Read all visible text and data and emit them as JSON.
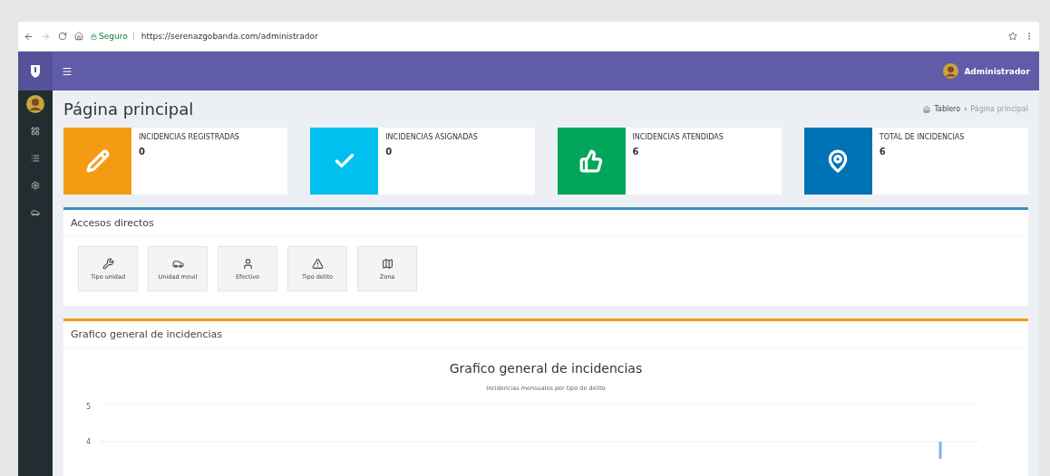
{
  "browser": {
    "security": "Seguro",
    "url": "https://serenazgobanda.com/administrador"
  },
  "header": {
    "user": "Administrador"
  },
  "page": {
    "title": "Página principal",
    "breadcrumb": [
      "Tablero",
      "Página principal"
    ],
    "separator": "›"
  },
  "stats": [
    {
      "kind": "pencil",
      "label": "INCIDENCIAS REGISTRADAS",
      "value": "0",
      "color": "#f39c12"
    },
    {
      "kind": "check",
      "label": "INCIDENCIAS ASIGNADAS",
      "value": "0",
      "color": "#00c0ef"
    },
    {
      "kind": "thumb",
      "label": "INCIDENCIAS ATENDIDAS",
      "value": "6",
      "color": "#00a65a"
    },
    {
      "kind": "pin",
      "label": "TOTAL DE INCIDENCIAS",
      "value": "6",
      "color": "#0073b7"
    }
  ],
  "shortcuts": {
    "title": "Accesos directos",
    "items": [
      {
        "kind": "wrench",
        "label": "Tipo unidad"
      },
      {
        "kind": "car",
        "label": "Unidad movil"
      },
      {
        "kind": "user",
        "label": "Efectivo"
      },
      {
        "kind": "warning",
        "label": "Tipo delito"
      },
      {
        "kind": "map",
        "label": "Zona"
      }
    ]
  },
  "chart_panel": {
    "title": "Grafico general de incidencias",
    "subtitle": "Incidencias mensuales por tipo de delito",
    "chart_data": {
      "type": "bar",
      "title": "Grafico general de incidencias",
      "yticks": [
        4,
        5
      ],
      "ylim": [
        3.56,
        5
      ],
      "values": [
        null,
        null,
        null,
        null,
        null,
        null,
        null,
        null,
        null,
        null,
        null,
        4
      ]
    }
  }
}
